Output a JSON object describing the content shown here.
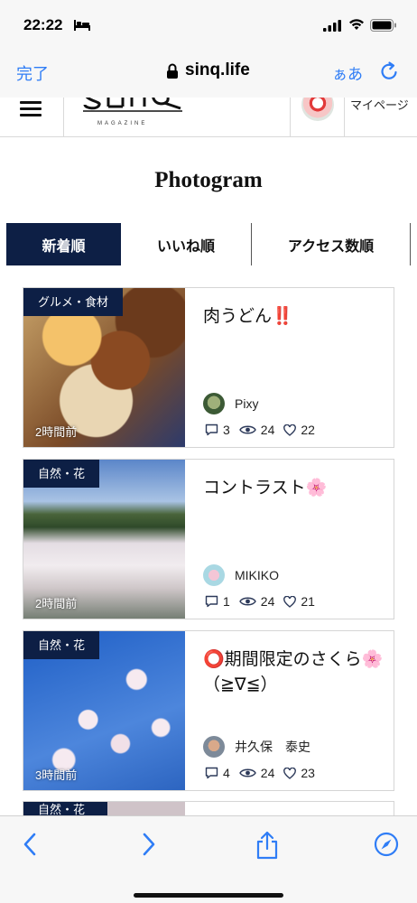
{
  "status_bar": {
    "time": "22:22"
  },
  "browser": {
    "done_label": "完了",
    "url": "sinq.life",
    "aa_label": "ぁあ"
  },
  "site_header": {
    "logo_sub": "MAGAZINE",
    "mypage_label": "マイページ"
  },
  "page": {
    "title": "Photogram"
  },
  "tabs": [
    {
      "label": "新着順",
      "active": true
    },
    {
      "label": "いいね順",
      "active": false
    },
    {
      "label": "アクセス数順",
      "active": false
    }
  ],
  "posts": [
    {
      "category": "グルメ・食材",
      "title": "肉うどん‼️",
      "age": "2時間前",
      "author": "Pixy",
      "comments": "3",
      "views": "24",
      "likes": "22"
    },
    {
      "category": "自然・花",
      "title": "コントラスト🌸",
      "age": "2時間前",
      "author": "MIKIKO",
      "comments": "1",
      "views": "24",
      "likes": "21"
    },
    {
      "category": "自然・花",
      "title": "⭕️期間限定のさくら🌸（≧∇≦）",
      "age": "3時間前",
      "author": "井久保　泰史",
      "comments": "4",
      "views": "24",
      "likes": "23"
    }
  ],
  "peek_card": {
    "category": "自然・花"
  },
  "colors": {
    "accent": "#2f7df6",
    "navy": "#0d1f45"
  }
}
